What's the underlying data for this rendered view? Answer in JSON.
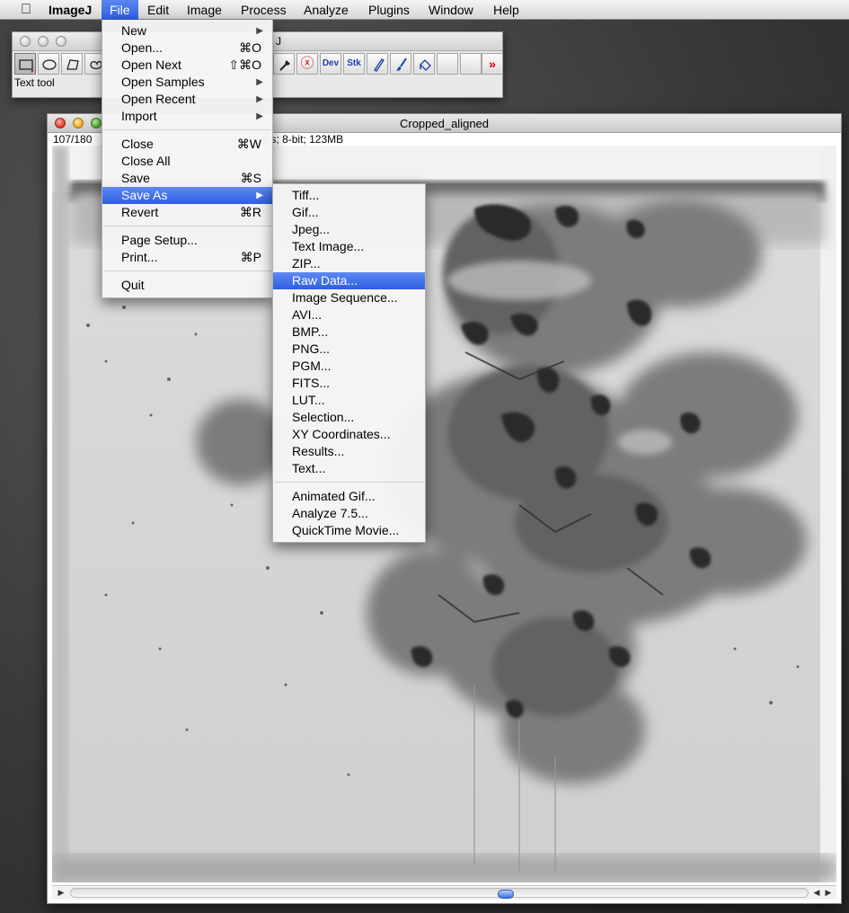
{
  "menubar": {
    "app": "ImageJ",
    "items": [
      "File",
      "Edit",
      "Image",
      "Process",
      "Analyze",
      "Plugins",
      "Window",
      "Help"
    ]
  },
  "toolbar_window": {
    "title_fragment": "J",
    "status": "Text tool",
    "tools": [
      {
        "icon": "rectangle-selection-icon"
      },
      {
        "icon": "oval-selection-icon"
      },
      {
        "icon": "polygon-selection-icon"
      },
      {
        "icon": "freehand-selection-icon"
      },
      {
        "icon": "color-picker-icon"
      },
      {
        "icon": "remove-overlay-icon",
        "text": "ⓧ"
      },
      {
        "icon": "developer-menu-icon",
        "text": "Dev"
      },
      {
        "icon": "stack-tools-icon",
        "text": "Stk"
      },
      {
        "icon": "pencil-icon"
      },
      {
        "icon": "brush-icon"
      },
      {
        "icon": "flood-fill-icon"
      },
      {
        "icon": "empty-slot-icon"
      },
      {
        "icon": "empty-slot-icon"
      },
      {
        "icon": "more-tools-icon",
        "text": "»"
      }
    ]
  },
  "image_window": {
    "title": "Cropped_aligned",
    "info_start": "107/180",
    "info_end": "els; 8-bit; 123MB"
  },
  "file_menu": [
    {
      "label": "New",
      "shortcut": "",
      "submenu": true
    },
    {
      "label": "Open...",
      "shortcut": "⌘O",
      "submenu": false
    },
    {
      "label": "Open Next",
      "shortcut": "⇧⌘O",
      "submenu": false
    },
    {
      "label": "Open Samples",
      "shortcut": "",
      "submenu": true
    },
    {
      "label": "Open Recent",
      "shortcut": "",
      "submenu": true
    },
    {
      "label": "Import",
      "shortcut": "",
      "submenu": true
    },
    {
      "separator": true
    },
    {
      "label": "Close",
      "shortcut": "⌘W",
      "submenu": false
    },
    {
      "label": "Close All",
      "shortcut": "",
      "submenu": false
    },
    {
      "label": "Save",
      "shortcut": "⌘S",
      "submenu": false
    },
    {
      "label": "Save As",
      "shortcut": "",
      "submenu": true,
      "highlighted": true
    },
    {
      "label": "Revert",
      "shortcut": "⌘R",
      "submenu": false
    },
    {
      "separator": true
    },
    {
      "label": "Page Setup...",
      "shortcut": "",
      "submenu": false
    },
    {
      "label": "Print...",
      "shortcut": "⌘P",
      "submenu": false
    },
    {
      "separator": true
    },
    {
      "label": "Quit",
      "shortcut": "",
      "submenu": false
    }
  ],
  "save_as_menu": [
    {
      "label": "Tiff..."
    },
    {
      "label": "Gif..."
    },
    {
      "label": "Jpeg..."
    },
    {
      "label": "Text Image..."
    },
    {
      "label": "ZIP..."
    },
    {
      "label": "Raw Data...",
      "highlighted": true
    },
    {
      "label": "Image Sequence..."
    },
    {
      "label": "AVI..."
    },
    {
      "label": "BMP..."
    },
    {
      "label": "PNG..."
    },
    {
      "label": "PGM..."
    },
    {
      "label": "FITS..."
    },
    {
      "label": "LUT..."
    },
    {
      "label": "Selection..."
    },
    {
      "label": "XY Coordinates..."
    },
    {
      "label": "Results..."
    },
    {
      "label": "Text..."
    },
    {
      "separator": true
    },
    {
      "label": "Animated Gif..."
    },
    {
      "label": "Analyze 7.5..."
    },
    {
      "label": "QuickTime Movie..."
    }
  ],
  "colors": {
    "menu_highlight": "#3a6ae6",
    "close_button": "#e0302a",
    "minimize_button": "#e7a31b",
    "zoom_button": "#4cae2b",
    "scroll_thumb": "#3c73e6"
  }
}
